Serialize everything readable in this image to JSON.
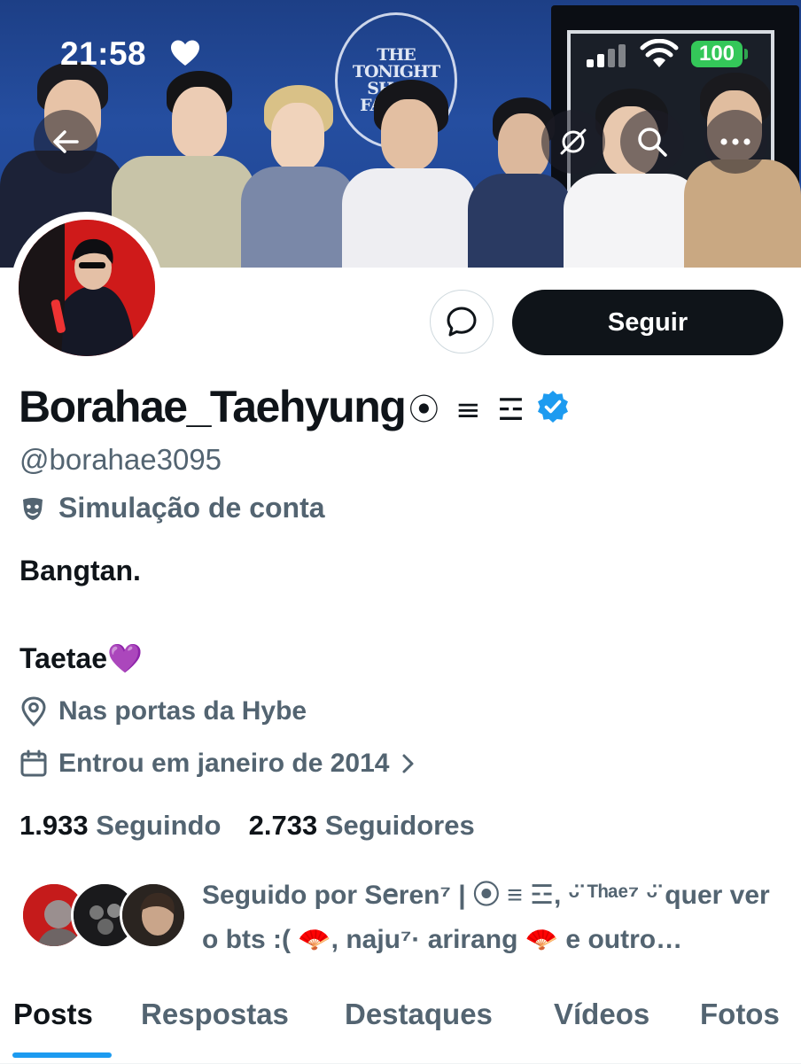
{
  "status_bar": {
    "time": "21:58",
    "battery": "100"
  },
  "banner": {
    "logo_lines": [
      "THE",
      "TONIGHT",
      "SHOW",
      "FALLON"
    ]
  },
  "profile": {
    "display_name": "Borahae_Taehyung",
    "name_decoration": "⦿ ≡ ☲",
    "handle": "@borahae3095",
    "parody_label": "Simulação de conta",
    "bio_line1": "Bangtan.",
    "bio_line2": "Taetae💜",
    "location": "Nas portas da Hybe",
    "joined": "Entrou em janeiro de 2014",
    "following_count": "1.933",
    "following_label": "Seguindo",
    "followers_count": "2.733",
    "followers_label": "Seguidores",
    "followed_by": "Seguido por S𝖾ren⁷ | ⦿ ≡ ☲, ᵕ̈ ᵀʰᵃᵉ⁷ ᵕ̈ quer ver o bts :( 🪭, naju⁷· arirang 🪭 e outro…"
  },
  "actions": {
    "follow_label": "Seguir"
  },
  "tabs": [
    "Posts",
    "Respostas",
    "Destaques",
    "Vídeos",
    "Fotos"
  ],
  "colors": {
    "accent": "#1d9bf0",
    "text": "#0f1419",
    "secondary": "#536471",
    "follow_bg": "#0f1419",
    "battery": "#34c759"
  }
}
